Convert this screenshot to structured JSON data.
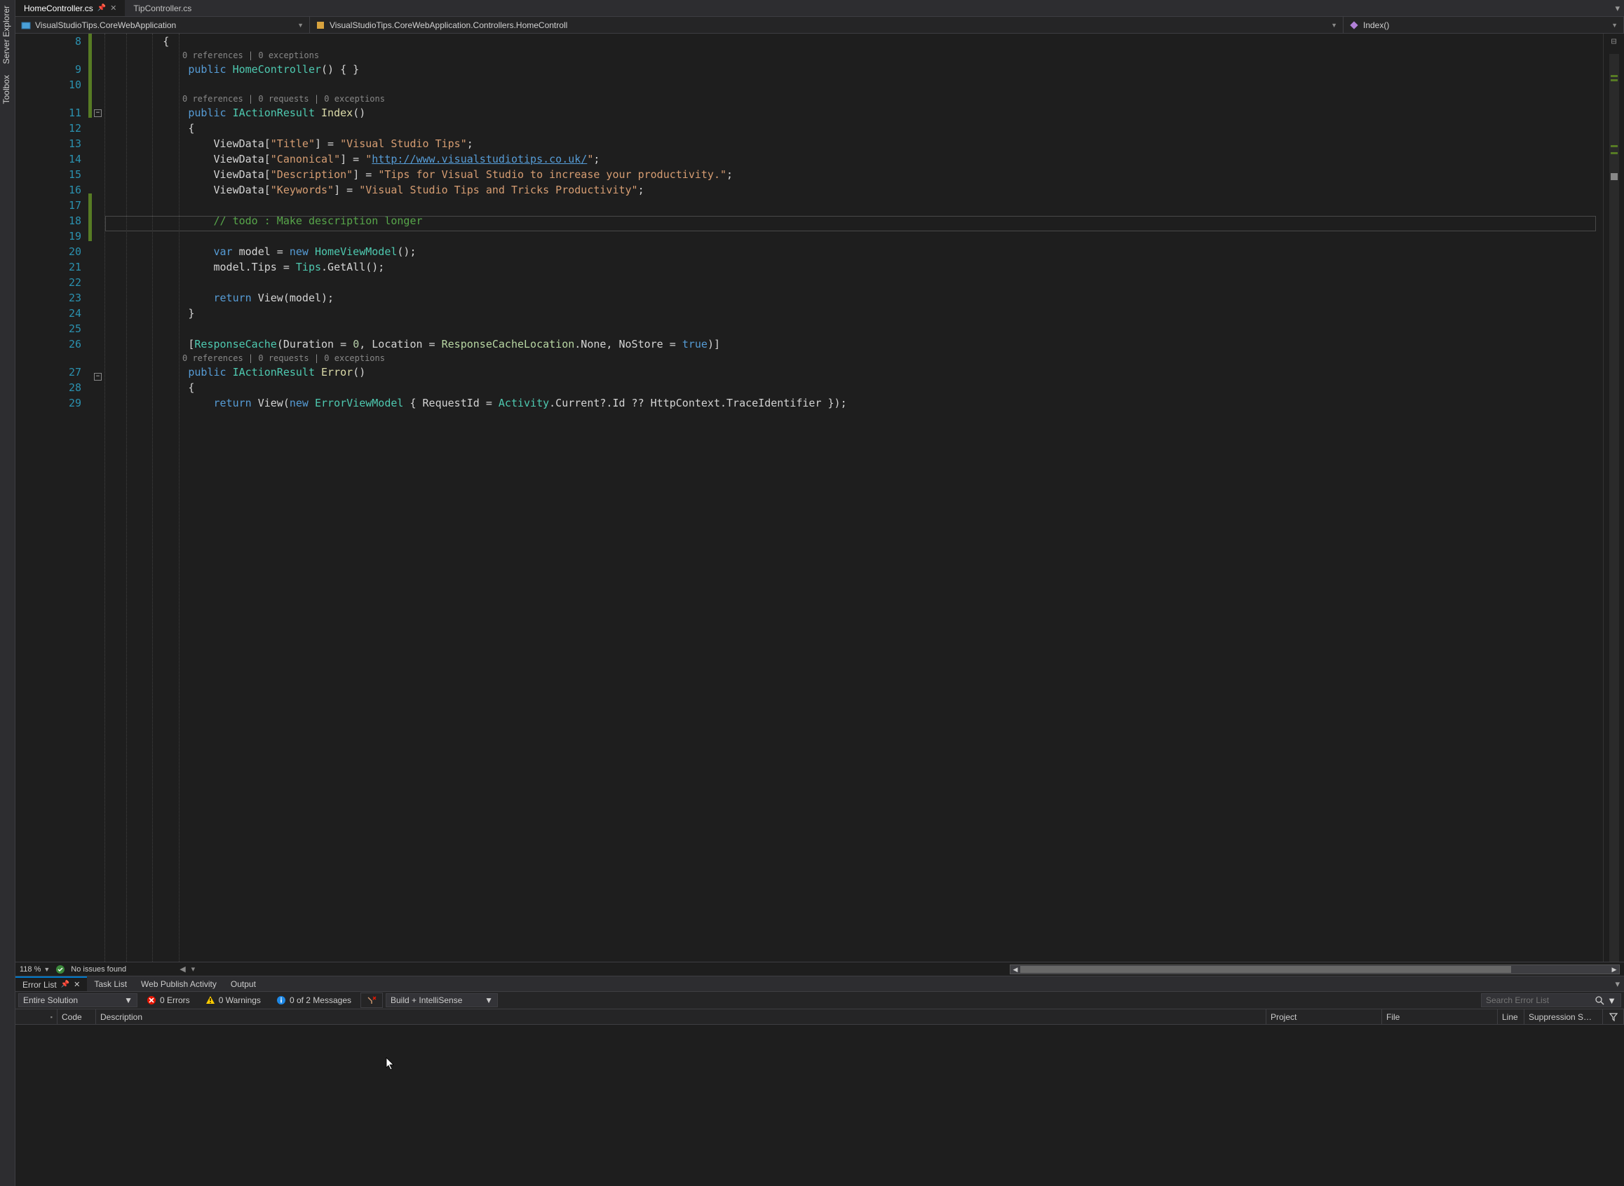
{
  "side_tabs": [
    "Server Explorer",
    "Toolbox"
  ],
  "file_tabs": [
    {
      "label": "HomeController.cs",
      "active": true,
      "pinned": true
    },
    {
      "label": "TipController.cs",
      "active": false,
      "pinned": false
    }
  ],
  "nav": {
    "project": "VisualStudioTips.CoreWebApplication",
    "type": "VisualStudioTips.CoreWebApplication.Controllers.HomeControll",
    "member": "Index()"
  },
  "zoom": "118 %",
  "status_issues": "No issues found",
  "code": {
    "l8": "        {",
    "lens1": "0 references | 0 exceptions",
    "l9a": "            ",
    "l9_public": "public",
    "l9_ctor": " HomeController",
    "l9b": "() { }",
    "lens2": "0 references | 0 requests | 0 exceptions",
    "l11a": "            ",
    "l11_public": "public",
    "l11_iact": " IActionResult",
    "l11_m": " Index",
    "l11b": "()",
    "l12": "            {",
    "l13a": "                ViewData[",
    "l13k": "\"Title\"",
    "l13b": "] = ",
    "l13v": "\"Visual Studio Tips\"",
    "l13c": ";",
    "l14a": "                ViewData[",
    "l14k": "\"Canonical\"",
    "l14b": "] = ",
    "l14q": "\"",
    "l14u": "http://www.visualstudiotips.co.uk/",
    "l14q2": "\"",
    "l14c": ";",
    "l15a": "                ViewData[",
    "l15k": "\"Description\"",
    "l15b": "] = ",
    "l15v": "\"Tips for Visual Studio to increase your productivity.\"",
    "l15c": ";",
    "l16a": "                ViewData[",
    "l16k": "\"Keywords\"",
    "l16b": "] = ",
    "l16v": "\"Visual Studio Tips and Tricks Productivity\"",
    "l16c": ";",
    "l18": "                // todo : Make description longer",
    "l20a": "                ",
    "l20v": "var",
    "l20b": " model = ",
    "l20n": "new",
    "l20t": " HomeViewModel",
    "l20c": "();",
    "l21a": "                model.Tips = ",
    "l21t": "Tips",
    "l21b": ".GetAll();",
    "l23a": "                ",
    "l23r": "return",
    "l23b": " View(model);",
    "l24": "            }",
    "l26a": "            [",
    "l26t": "ResponseCache",
    "l26b": "(Duration = ",
    "l26n1": "0",
    "l26c": ", Location = ",
    "l26e": "ResponseCacheLocation",
    "l26d": ".None, NoStore = ",
    "l26tr": "true",
    "l26e2": ")]",
    "lens3": "0 references | 0 requests | 0 exceptions",
    "l27a": "            ",
    "l27p": "public",
    "l27i": " IActionResult",
    "l27m": " Error",
    "l27b": "()",
    "l28": "            {",
    "l29a": "                ",
    "l29r": "return",
    "l29b": " View(",
    "l29n": "new",
    "l29t": " ErrorViewModel",
    "l29c": " { RequestId = ",
    "l29act": "Activity",
    "l29d": ".Current?.Id ?? HttpContext.TraceIdentifier });"
  },
  "line_numbers": [
    "8",
    "9",
    "10",
    "11",
    "12",
    "13",
    "14",
    "15",
    "16",
    "17",
    "18",
    "19",
    "20",
    "21",
    "22",
    "23",
    "24",
    "25",
    "26",
    "27",
    "28",
    "29"
  ],
  "panel_tabs": [
    {
      "label": "Error List",
      "active": true
    },
    {
      "label": "Task List",
      "active": false
    },
    {
      "label": "Web Publish Activity",
      "active": false
    },
    {
      "label": "Output",
      "active": false
    }
  ],
  "toolbar": {
    "scope": "Entire Solution",
    "errors": "0 Errors",
    "warnings": "0 Warnings",
    "messages": "0 of 2 Messages",
    "mode": "Build + IntelliSense",
    "search_placeholder": "Search Error List"
  },
  "columns": {
    "code": "Code",
    "description": "Description",
    "project": "Project",
    "file": "File",
    "line": "Line",
    "suppression": "Suppression S…"
  }
}
